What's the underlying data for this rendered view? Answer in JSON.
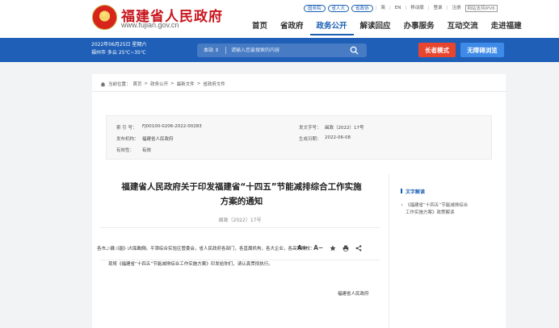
{
  "header": {
    "site_name": "福建省人民政府",
    "site_url": "www.fujian.gov.cn",
    "top_links": {
      "pill1": "国务院",
      "pill2": "省人大",
      "pill3": "省政协",
      "simplified": "简",
      "english": "EN",
      "mobile": "移动版",
      "login": "登录",
      "register": "注册",
      "ipv6": "网站支持IPV6"
    },
    "nav": [
      {
        "label": "首页"
      },
      {
        "label": "省政府"
      },
      {
        "label": "政务公开"
      },
      {
        "label": "解读回应"
      },
      {
        "label": "办事服务"
      },
      {
        "label": "互动交流"
      },
      {
        "label": "走进福建"
      }
    ]
  },
  "banner": {
    "date": "2022年06月25日 星期六",
    "weather": "福州市 多云 25℃~35℃",
    "search_scope": "本站 ⇕",
    "search_placeholder": "请输入您要搜索的内容",
    "elder_mode": "长者模式",
    "accessible": "无障碍浏览"
  },
  "breadcrumb": {
    "label": "当前位置：",
    "items": [
      "首页",
      "政务公开",
      "最新文件",
      "省政府文件"
    ],
    "sep": ">"
  },
  "meta": {
    "index_k": "索 引 号：",
    "index_v": "FJ00100-0206-2022-00283",
    "issuer_k": "发布机构：",
    "issuer_v": "福建省人民政府",
    "validity_k": "有效性：",
    "validity_v": "有效",
    "docno_k": "发文字号：",
    "docno_v": "闽政〔2022〕17号",
    "date_k": "生成日期：",
    "date_v": "2022-06-08"
  },
  "article": {
    "title_line1": "福建省人民政府关于印发福建省“十四五”节能减排综合工作实施",
    "title_line2": "方案的通知",
    "doc_number": "闽政〔2022〕17号",
    "publish_time": "2022-06-17 16:59",
    "font_increase": "A+",
    "font_decrease": "A−",
    "paragraph1": "各市、县（区）人民政府，平潭综合实验区管委会，省人民政府各部门，各直属机构，各大企业，各高等院校：",
    "paragraph2": "现将《福建省“十四五”节能减排综合工作实施方案》印发给你们，请认真贯彻执行。",
    "signature": "福建省人民政府"
  },
  "sidebar": {
    "title": "文字解读",
    "link_line1": "《福建省“十四五”节能减排综合",
    "link_line2": "工作实施方案》政策解读"
  }
}
